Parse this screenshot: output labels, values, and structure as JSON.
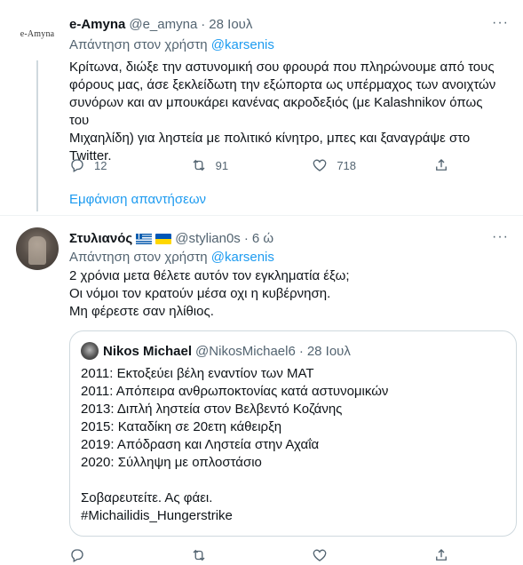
{
  "tweets": [
    {
      "avatar_text": "e-Amyna",
      "name": "e-Amyna",
      "handle": "@e_amyna",
      "dot": "·",
      "time": "28 Ιουλ",
      "reply_prefix": "Απάντηση στον χρήστη",
      "reply_to": "@karsenis",
      "lines": [
        "Κρίτωνα, διώξε την αστυνομική σου φρουρά που πληρώνουμε από τους",
        "φόρους μας, άσε ξεκλείδωτη την εξώπορτα ως υπέρμαχος των ανοιχτών",
        "συνόρων και αν μπουκάρει κανένας ακροδεξιός (με Kalashnikov όπως του",
        "Μιχαηλίδη) για ληστεία με πολιτικό κίνητρο, μπες και ξαναγράψε στο",
        "Twitter."
      ],
      "stats": {
        "replies": "12",
        "retweets": "91",
        "likes": "718"
      },
      "show_replies": "Εμφάνιση απαντήσεων"
    },
    {
      "name": "Στυλιανός",
      "handle": "@stylian0s",
      "dot": "·",
      "time": "6 ώ",
      "reply_prefix": "Απάντηση στον χρήστη",
      "reply_to": "@karsenis",
      "lines": [
        "2 χρόνια μετα θέλετε αυτόν τον εγκληματία έξω;",
        "Οι νόμοι τον κρατούν μέσα οχι η κυβέρνηση.",
        "Μη φέρεστε σαν ηλίθιος."
      ],
      "quote": {
        "name": "Nikos Michael",
        "handle": "@NikosMichael6",
        "dot": "·",
        "time": "28 Ιουλ",
        "lines": [
          "2011: Εκτοξεύει βέλη εναντίον των ΜΑΤ",
          "2011: Απόπειρα ανθρωποκτονίας κατά αστυνομικών",
          "2013: Διπλή ληστεία στον Βελβεντό Κοζάνης",
          "2015: Καταδίκη σε 20ετη κάθειρξη",
          "2019: Απόδραση και Ληστεία στην Αχαΐα",
          "2020: Σύλληψη με οπλοστάσιο",
          "",
          "Σοβαρευτείτε. Ας φάει.",
          "#Michailidis_Hungerstrike"
        ]
      },
      "stats": {
        "replies": "",
        "retweets": "",
        "likes": ""
      }
    }
  ],
  "icons": {
    "reply": "speech-bubble-icon",
    "retweet": "retweet-icon",
    "like": "heart-icon",
    "share": "share-icon",
    "more": "more-dots-icon"
  },
  "colors": {
    "accent": "#1d9bf0",
    "secondary_text": "#536471",
    "border": "#cfd9de"
  }
}
